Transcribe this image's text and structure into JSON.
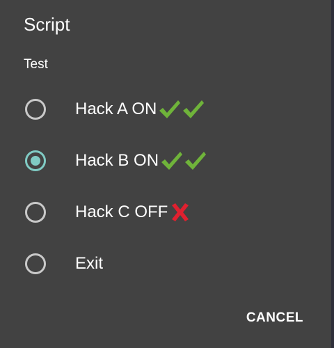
{
  "dialog": {
    "title": "Script",
    "message": "Test",
    "options": [
      {
        "label": "Hack A ON",
        "selected": false,
        "marks": [
          "check-mark-icon",
          "check-mark-icon"
        ]
      },
      {
        "label": "Hack B ON",
        "selected": true,
        "marks": [
          "check-mark-icon",
          "check-mark-icon"
        ]
      },
      {
        "label": "Hack C OFF",
        "selected": false,
        "marks": [
          "cross-mark-icon"
        ]
      },
      {
        "label": "Exit",
        "selected": false,
        "marks": []
      }
    ],
    "cancel_label": "CANCEL"
  },
  "colors": {
    "background": "#424242",
    "radio_unchecked": "#c9c9c9",
    "radio_checked": "#80cbc4",
    "check_mark": "#6fb33a",
    "cross_mark": "#e0202f"
  }
}
